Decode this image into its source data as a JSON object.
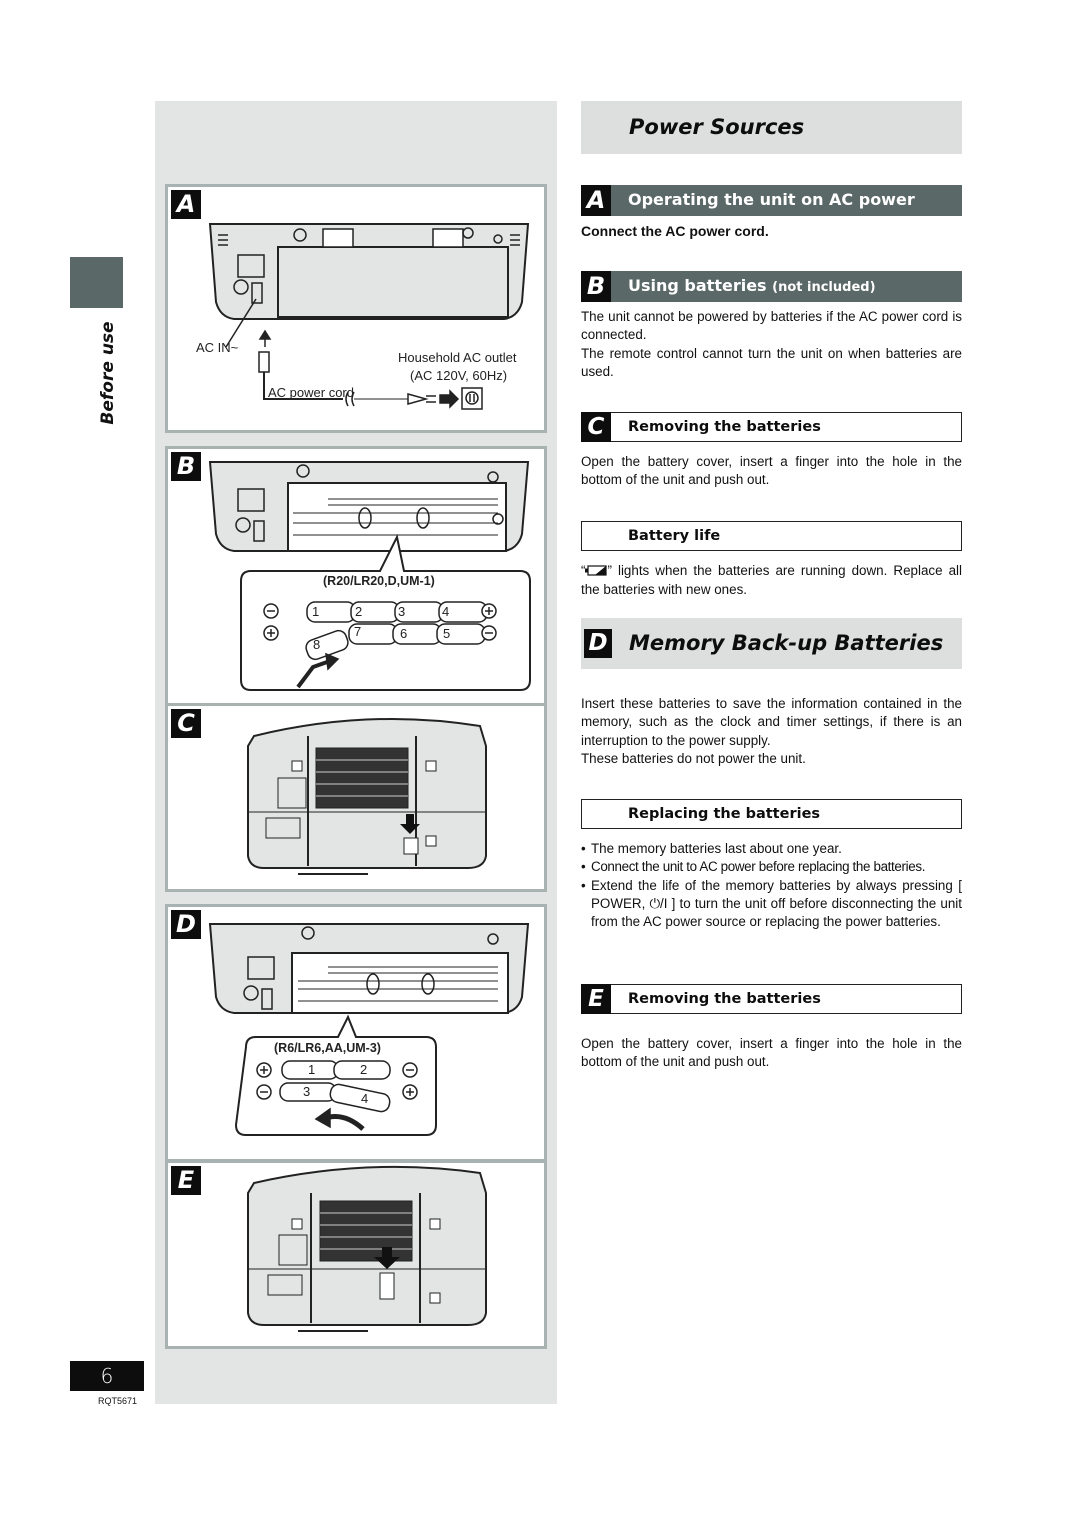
{
  "side": {
    "section_label": "Before use"
  },
  "footer": {
    "page_number": "6",
    "doc_code": "RQT5671"
  },
  "figures": {
    "A": {
      "letter": "A",
      "ac_in_label": "AC IN~",
      "outlet_label": "Household AC outlet",
      "outlet_spec": "(AC 120V, 60Hz)",
      "cord_label": "AC power cord"
    },
    "B": {
      "letter": "B",
      "battery_type": "(R20/LR20,D,UM-1)",
      "battery_numbers_top": [
        "1",
        "2",
        "3",
        "4"
      ],
      "battery_numbers_bottom": [
        "7",
        "6",
        "5"
      ],
      "battery_loose": "8",
      "left_top_polarity": "−",
      "left_bottom_polarity": "+",
      "right_top_polarity": "+",
      "right_bottom_polarity": "−"
    },
    "C": {
      "letter": "C"
    },
    "D": {
      "letter": "D",
      "battery_type": "(R6/LR6,AA,UM-3)",
      "battery_numbers": [
        "1",
        "2",
        "3",
        "4"
      ],
      "left_top_polarity": "+",
      "left_bottom_polarity": "−",
      "right_top_polarity": "−",
      "right_bottom_polarity": "+"
    },
    "E": {
      "letter": "E"
    }
  },
  "main": {
    "title": "Power Sources",
    "sections": {
      "A": {
        "letter": "A",
        "heading": "Operating the unit on AC power",
        "instruction": "Connect the AC power cord."
      },
      "B": {
        "letter": "B",
        "heading": "Using batteries",
        "heading_note": "(not included)",
        "paragraphs": [
          "The unit cannot be powered by batteries if the AC power cord is connected.",
          "The remote control cannot turn the unit on when batteries are used."
        ]
      },
      "C": {
        "letter": "C",
        "heading": "Removing the batteries",
        "text": "Open the battery cover, insert a finger into the hole in the bottom of the unit and push out."
      },
      "battery_life": {
        "heading": "Battery life",
        "icon": "low-battery-icon",
        "text_before": "“",
        "text_after": "” lights when the batteries are running down. Replace all the batteries with new ones."
      },
      "D": {
        "letter": "D",
        "heading": "Memory Back-up Batteries",
        "paragraphs": [
          "Insert these batteries to save the information contained in the memory, such as the clock and timer settings, if there is an interruption to the power supply.",
          "These batteries do not power the unit."
        ]
      },
      "replacing": {
        "heading": "Replacing the batteries",
        "bullets": [
          "The memory batteries last about one year.",
          "Connect the unit to AC power before replacing the batteries.",
          "Extend the life of the memory batteries by always pressing [ POWER, ⏻/I ] to turn the unit off before disconnecting the unit from the AC power source or replacing the power batteries."
        ]
      },
      "E": {
        "letter": "E",
        "heading": "Removing the batteries",
        "text": "Open the battery cover, insert a finger into the hole in the bottom of the unit and push out."
      }
    }
  },
  "colors": {
    "header_dark": "#5b6868",
    "title_band": "#dcdfde",
    "figure_column": "#e2e5e4",
    "panel_border": "#a8b2b1",
    "letter_badge": "#0d0d0d"
  }
}
